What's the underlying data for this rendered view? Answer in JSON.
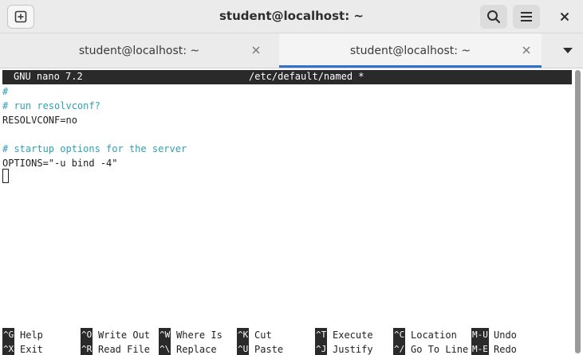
{
  "header": {
    "title": "student@localhost: ~",
    "new_tab_icon": "new-tab-icon",
    "search_icon": "search-icon",
    "menu_icon": "hamburger-menu-icon",
    "close_icon": "close-icon"
  },
  "tabs": [
    {
      "label": "student@localhost: ~",
      "active": false
    },
    {
      "label": "student@localhost: ~",
      "active": true
    }
  ],
  "nano": {
    "version": "GNU nano 7.2",
    "filename": "/etc/default/named *",
    "lines": [
      {
        "text": "#",
        "comment": true
      },
      {
        "text": "# run resolvconf?",
        "comment": true
      },
      {
        "text": "RESOLVCONF=no",
        "comment": false
      },
      {
        "text": "",
        "comment": false
      },
      {
        "text": "# startup options for the server",
        "comment": true
      },
      {
        "text": "OPTIONS=\"-u bind -4\"",
        "comment": false
      }
    ],
    "shortcuts_row1": [
      {
        "key": "^G",
        "label": "Help"
      },
      {
        "key": "^O",
        "label": "Write Out"
      },
      {
        "key": "^W",
        "label": "Where Is"
      },
      {
        "key": "^K",
        "label": "Cut"
      },
      {
        "key": "^T",
        "label": "Execute"
      },
      {
        "key": "^C",
        "label": "Location"
      },
      {
        "key": "M-U",
        "label": "Undo"
      }
    ],
    "shortcuts_row2": [
      {
        "key": "^X",
        "label": "Exit"
      },
      {
        "key": "^R",
        "label": "Read File"
      },
      {
        "key": "^\\",
        "label": "Replace"
      },
      {
        "key": "^U",
        "label": "Paste"
      },
      {
        "key": "^J",
        "label": "Justify"
      },
      {
        "key": "^/",
        "label": "Go To Line"
      },
      {
        "key": "M-E",
        "label": "Redo"
      }
    ]
  },
  "colors": {
    "comment": "#2fa0b5",
    "accent": "#2f6fcf",
    "status_bar": "#2a2a2a"
  }
}
